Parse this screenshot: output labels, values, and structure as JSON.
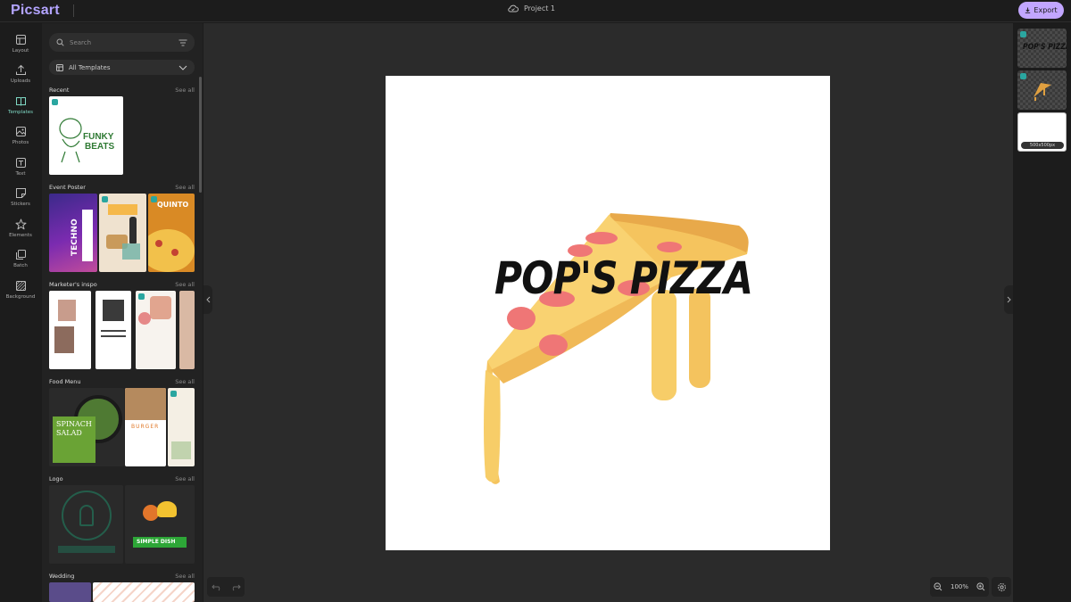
{
  "app": {
    "logo": "Picsart",
    "project_title": "Project 1",
    "export_label": "Export"
  },
  "rail": [
    {
      "label": "Layout",
      "icon": "layout-icon"
    },
    {
      "label": "Uploads",
      "icon": "upload-icon"
    },
    {
      "label": "Templates",
      "icon": "templates-icon",
      "active": true
    },
    {
      "label": "Photos",
      "icon": "photos-icon"
    },
    {
      "label": "Text",
      "icon": "text-icon"
    },
    {
      "label": "Stickers",
      "icon": "stickers-icon"
    },
    {
      "label": "Elements",
      "icon": "star-icon"
    },
    {
      "label": "Batch",
      "icon": "batch-icon"
    },
    {
      "label": "Background",
      "icon": "background-icon"
    }
  ],
  "panel": {
    "search_placeholder": "Search",
    "category_select": "All Templates",
    "see_all": "See all",
    "sections": {
      "recent": "Recent",
      "event_poster": "Event Poster",
      "marketers_inspo": "Marketer's inspo",
      "food_menu": "Food Menu",
      "logo": "Logo",
      "wedding": "Wedding"
    },
    "thumb_text": {
      "funky": "FUNKY",
      "beats": "BEATS",
      "techno": "TECHNO",
      "quinto": "QUINTO",
      "spinach": "SPINACH",
      "salad": "SALAD",
      "burger": "BURGER",
      "simple_dish": "SIMPLE DISH"
    }
  },
  "canvas": {
    "headline": "POP'S PIZZA",
    "zoom": "100%"
  },
  "layers": {
    "size_label": "500x500px",
    "layer1_text": "POP'S PIZZA"
  },
  "colors": {
    "accent": "#c2a6ff",
    "active_rail": "#7fd8c4",
    "badge": "#2aa6a0",
    "pizza_crust": "#f7c96a",
    "pepperoni": "#ef7676"
  }
}
